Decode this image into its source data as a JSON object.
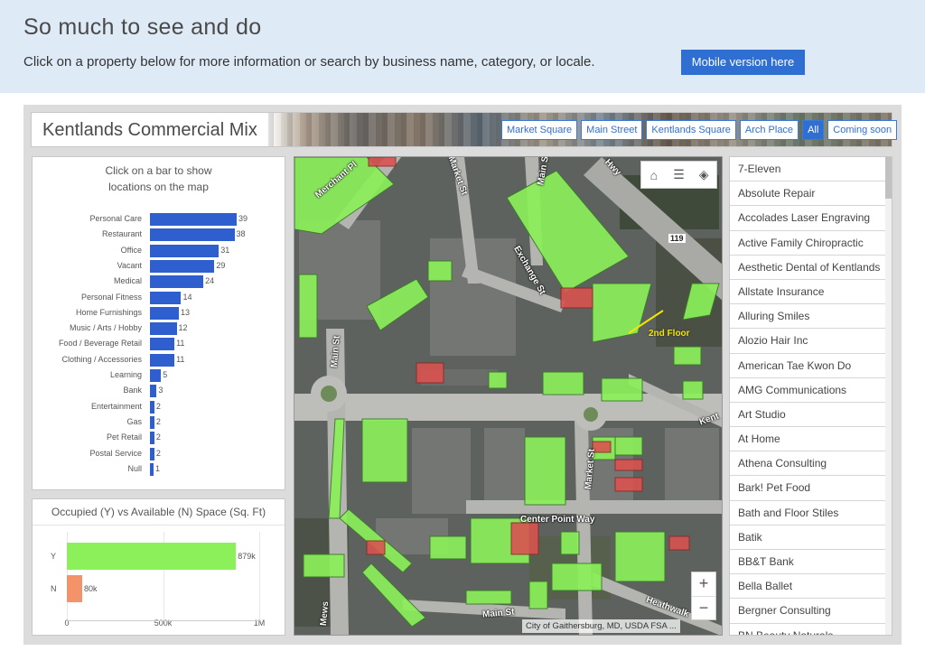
{
  "hero": {
    "title": "So much to see and do",
    "subtitle": "Click on a property below for more information or search by business name, category, or locale.",
    "mobile_button": "Mobile version here"
  },
  "dashboard": {
    "title": "Kentlands Commercial Mix",
    "filters": [
      {
        "label": "Market Square",
        "active": false
      },
      {
        "label": "Main Street",
        "active": false
      },
      {
        "label": "Kentlands Square",
        "active": false
      },
      {
        "label": "Arch Place",
        "active": false
      },
      {
        "label": "All",
        "active": true
      },
      {
        "label": "Coming soon",
        "active": false
      }
    ]
  },
  "category_panel": {
    "title_line1": "Click on a bar to show",
    "title_line2": "locations on the map"
  },
  "occupancy_panel": {
    "title": "Occupied (Y) vs Available (N) Space (Sq. Ft)"
  },
  "chart_data": [
    {
      "type": "bar",
      "orientation": "horizontal",
      "categories": [
        "Personal Care",
        "Restaurant",
        "Office",
        "Vacant",
        "Medical",
        "Personal Fitness",
        "Home Furnishings",
        "Music / Arts / Hobby",
        "Food / Beverage Retail",
        "Clothing / Accessories",
        "Learning",
        "Bank",
        "Entertainment",
        "Gas",
        "Pet Retail",
        "Postal Service",
        "Null"
      ],
      "values": [
        39,
        38,
        31,
        29,
        24,
        14,
        13,
        12,
        11,
        11,
        5,
        3,
        2,
        2,
        2,
        2,
        1
      ],
      "data_labels": [
        "39",
        "38",
        "31",
        "29",
        "24",
        "14",
        "13",
        "12",
        "11",
        "11",
        "5",
        "3",
        "2",
        "2",
        "2",
        "2",
        "1"
      ],
      "bar_color": "#2f5fcf",
      "xlim": [
        0,
        39
      ]
    },
    {
      "type": "bar",
      "orientation": "horizontal",
      "categories": [
        "Y",
        "N"
      ],
      "values": [
        879000,
        80000
      ],
      "data_labels": [
        "879k",
        "80k"
      ],
      "colors": [
        "#8bf05a",
        "#f4926a"
      ],
      "xlim": [
        0,
        1000000
      ],
      "xticks": [
        0,
        500000,
        1000000
      ],
      "xtick_labels": [
        "0",
        "500k",
        "1M"
      ],
      "grid": true
    }
  ],
  "map": {
    "tools": [
      {
        "name": "home-icon",
        "glyph": "⌂"
      },
      {
        "name": "legend-list-icon",
        "glyph": "☰"
      },
      {
        "name": "layers-icon",
        "glyph": "◈"
      }
    ],
    "zoom_in": "+",
    "zoom_out": "−",
    "attribution": "City of Gaithersburg, MD, USDA FSA",
    "attribution_more": "...",
    "labels": {
      "merchant_pl": "Merchant Pl",
      "market_st_top": "Market St",
      "main_st_top": "Main St",
      "hwy": "Hwy",
      "exchange_st": "Exchange St",
      "route": "119",
      "second_floor": "2nd Floor",
      "main_st_left": "Main St",
      "kent": "Kent",
      "market_st_bottom": "Market St",
      "center_point_way": "Center Point Way",
      "heathwalk": "Heathwalk",
      "mews": "Mews",
      "main_st_bottom": "Main St"
    },
    "colors": {
      "occupied": "#8bf05a",
      "available": "#d9534f",
      "road": "#c8c8c4",
      "lot": "#6d706d"
    }
  },
  "business_list": [
    "7-Eleven",
    "Absolute Repair",
    "Accolades Laser Engraving",
    "Active Family Chiropractic",
    "Aesthetic Dental of Kentlands",
    "Allstate Insurance",
    "Alluring Smiles",
    "Alozio Hair Inc",
    "American Tae Kwon Do",
    "AMG Communications",
    "Art Studio",
    "At Home",
    "Athena Consulting",
    "Bark! Pet Food",
    "Bath and Floor Stiles",
    "Batik",
    "BB&T Bank",
    "Bella Ballet",
    "Bergner Consulting",
    "BN Beauty Naturals"
  ]
}
